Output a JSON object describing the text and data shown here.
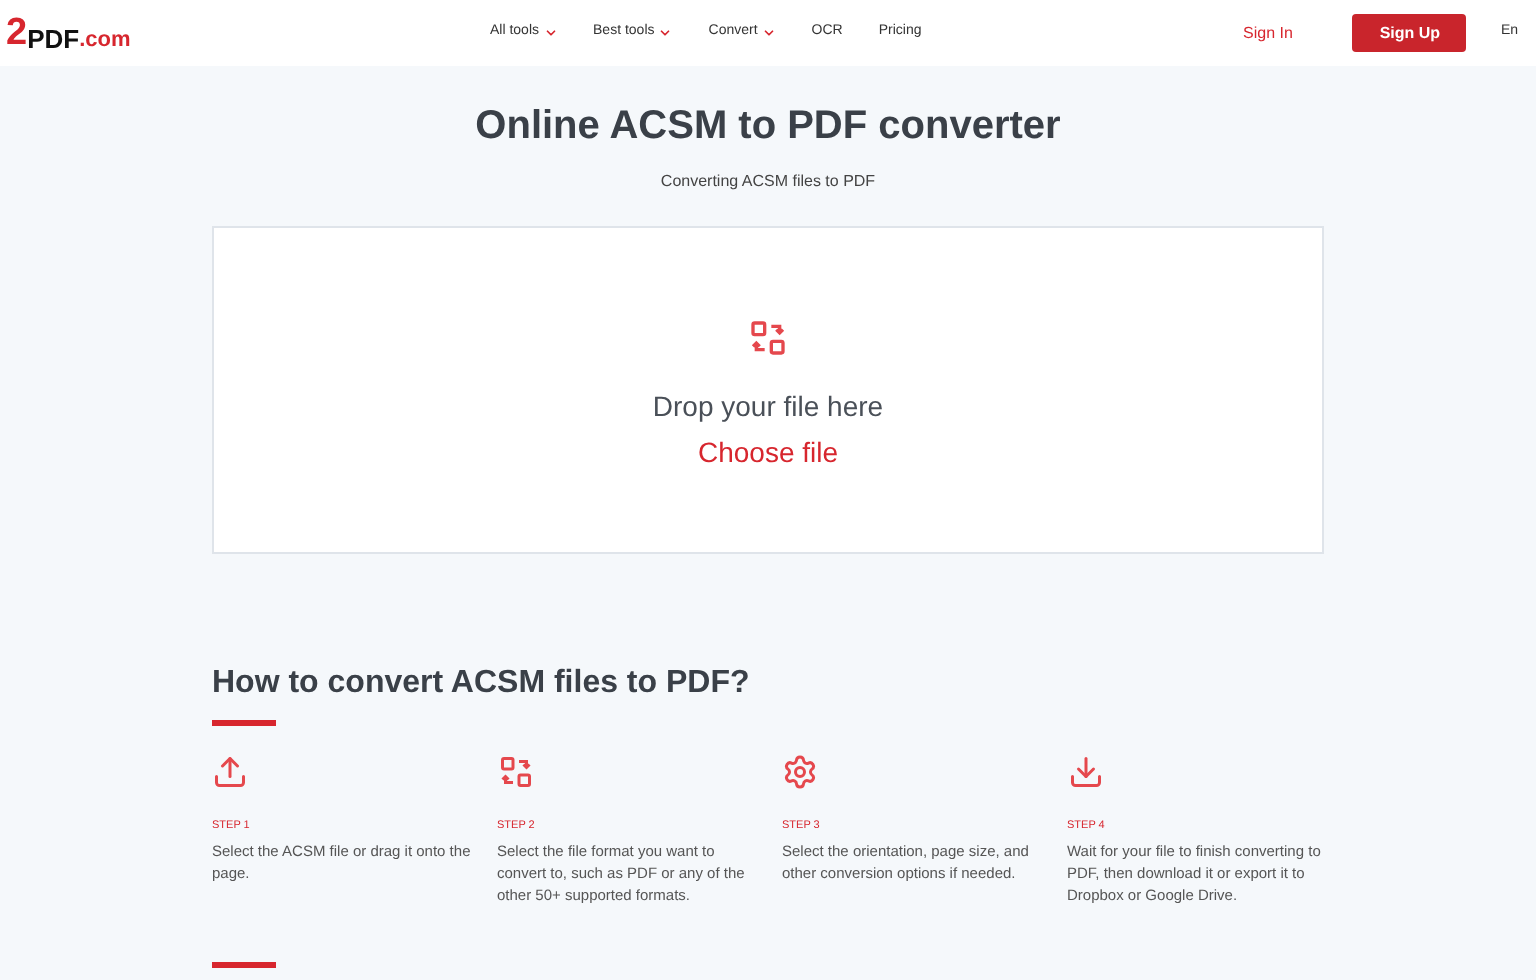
{
  "header": {
    "logo": {
      "digit": "2",
      "name": "PDF",
      "suffix": ".com"
    },
    "nav": [
      {
        "label": "All tools",
        "has_menu": true
      },
      {
        "label": "Best tools",
        "has_menu": true
      },
      {
        "label": "Convert",
        "has_menu": true
      },
      {
        "label": "OCR",
        "has_menu": false
      },
      {
        "label": "Pricing",
        "has_menu": false
      }
    ],
    "sign_in": "Sign In",
    "sign_up": "Sign Up",
    "language": "En"
  },
  "hero": {
    "title": "Online ACSM to PDF converter",
    "subtitle": "Converting ACSM files to PDF"
  },
  "dropzone": {
    "prompt": "Drop your file here",
    "action": "Choose file"
  },
  "howto": {
    "title": "How to convert ACSM files to PDF?",
    "steps": [
      {
        "kind": "upload",
        "label": "STEP 1",
        "text": "Select the ACSM file or drag it onto the page."
      },
      {
        "kind": "convert",
        "label": "STEP 2",
        "text": "Select the file format you want to convert to, such as PDF or any of the other 50+ supported formats."
      },
      {
        "kind": "settings",
        "label": "STEP 3",
        "text": "Select the orientation, page size, and other conversion options if needed."
      },
      {
        "kind": "download",
        "label": "STEP 4",
        "text": "Wait for your file to finish converting to PDF, then download it or export it to Dropbox or Google Drive."
      }
    ]
  }
}
